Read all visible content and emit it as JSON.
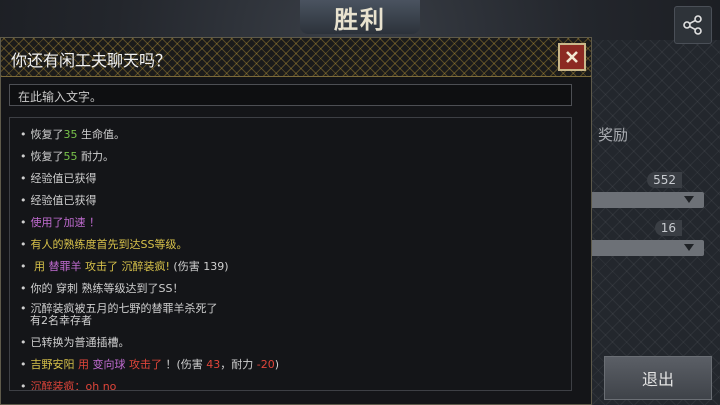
{
  "background": {
    "victory_title": "胜利",
    "reward_label": "奖励",
    "reward_sub_label": "奖励",
    "reward_value_1": "552",
    "reward_value_2": "16",
    "exit_label": "退出"
  },
  "chat": {
    "title": "你还有闲工夫聊天吗？",
    "input_placeholder": "在此输入文字。",
    "lines": [
      {
        "parts": [
          [
            "w",
            "恢复了"
          ],
          [
            "g",
            "35"
          ],
          [
            "w",
            " 生命值。"
          ]
        ]
      },
      {
        "parts": [
          [
            "w",
            "恢复了"
          ],
          [
            "g",
            "55"
          ],
          [
            "w",
            " 耐力。"
          ]
        ]
      },
      {
        "parts": [
          [
            "w",
            "经验值已获得"
          ]
        ]
      },
      {
        "parts": [
          [
            "w",
            "经验值已获得"
          ]
        ]
      },
      {
        "parts": [
          [
            "p",
            "使用了"
          ],
          [
            "p",
            "加速"
          ],
          [
            "p",
            " ！"
          ]
        ]
      },
      {
        "parts": [
          [
            "y",
            "有人的熟练度首先到达SS等级。"
          ]
        ]
      },
      {
        "parts": [
          [
            "y",
            " 用 "
          ],
          [
            "p",
            "替罪羊"
          ],
          [
            "y",
            " 攻击了 "
          ],
          [
            "y",
            " 沉醉装疯!"
          ],
          [
            "w",
            " (伤害 139)"
          ]
        ]
      },
      {
        "parts": [
          [
            "w",
            "你的 穿刺 熟练等级达到了SS！"
          ]
        ]
      },
      {
        "parts": [
          [
            "w",
            "沉醉装疯被五月的七野的替罪羊杀死了"
          ]
        ]
      },
      {
        "parts": [
          [
            "w",
            "有2名幸存者"
          ]
        ]
      },
      {
        "parts": [
          [
            "w",
            "已转换为普通插槽。"
          ]
        ]
      },
      {
        "parts": [
          [
            "y",
            "吉野安阳"
          ],
          [
            "r",
            " 用 "
          ],
          [
            "p",
            "变向球"
          ],
          [
            "r",
            " 攻击了 "
          ],
          [
            "w",
            "！(伤害 "
          ],
          [
            "r",
            "43"
          ],
          [
            "w",
            "，耐力  "
          ],
          [
            "r",
            "-20"
          ],
          [
            "w",
            ")"
          ]
        ]
      },
      {
        "parts": [
          [
            "r",
            "沉醉装疯：oh no"
          ]
        ]
      }
    ]
  },
  "colors": {
    "accent_gold": "#c9b78a",
    "close_red": "#8c2a22",
    "green": "#78c24a",
    "purple": "#c06bd0",
    "yellow": "#d8c24a",
    "red": "#e0453a"
  },
  "icons": {
    "share": "share-icon",
    "close": "close-icon",
    "dropdown": "chevron-down-icon"
  }
}
